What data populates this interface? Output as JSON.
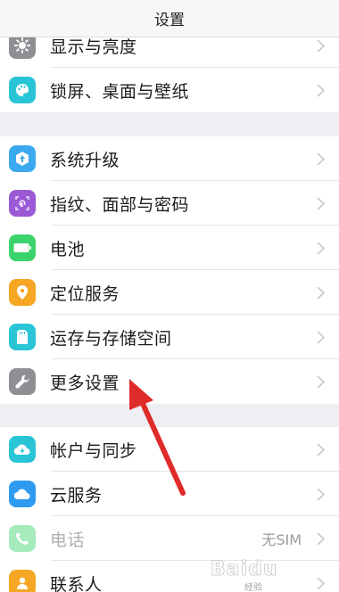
{
  "header": {
    "title": "设置"
  },
  "group1": [
    {
      "label": "显示与亮度",
      "icon": "sun-icon",
      "color": "#8e8e93"
    },
    {
      "label": "锁屏、桌面与壁纸",
      "icon": "palette-icon",
      "color": "#29c5d6"
    }
  ],
  "group2": [
    {
      "label": "系统升级",
      "icon": "upgrade-icon",
      "color": "#3aa9f0"
    },
    {
      "label": "指纹、面部与密码",
      "icon": "fingerprint-icon",
      "color": "#9b59d6"
    },
    {
      "label": "电池",
      "icon": "battery-icon",
      "color": "#3bd36b"
    },
    {
      "label": "定位服务",
      "icon": "location-pin-icon",
      "color": "#f5a623"
    },
    {
      "label": "运存与存储空间",
      "icon": "storage-icon",
      "color": "#29c5d6"
    },
    {
      "label": "更多设置",
      "icon": "wrench-icon",
      "color": "#8e8e93"
    }
  ],
  "group3": [
    {
      "label": "帐户与同步",
      "icon": "cloud-sync-icon",
      "color": "#29c5d6"
    },
    {
      "label": "云服务",
      "icon": "cloud-icon",
      "color": "#2e9bf0"
    },
    {
      "label": "电话",
      "icon": "phone-icon",
      "color": "#3bd36b",
      "value": "无SIM"
    },
    {
      "label": "联系人",
      "icon": "contacts-icon",
      "color": "#f5a623"
    }
  ],
  "watermark": {
    "brand": "Baidu",
    "sub": "经验"
  }
}
